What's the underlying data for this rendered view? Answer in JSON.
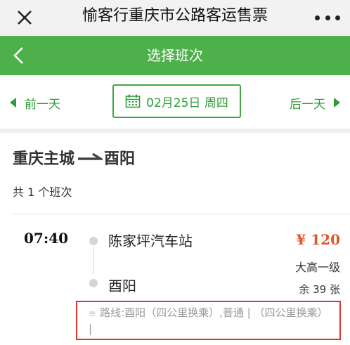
{
  "wechat_bar": {
    "title": "愉客行重庆市公路客运售票"
  },
  "nav": {
    "title": "选择班次"
  },
  "date_selector": {
    "prev_label": "前一天",
    "current_date": "02月25日 周四",
    "next_label": "后一天"
  },
  "route": {
    "from": "重庆主城",
    "to": "酉阳",
    "trip_count": "共 1 个班次"
  },
  "trips": [
    {
      "time": "07:40",
      "from_station": "陈家坪汽车站",
      "to_station": "酉阳",
      "price": "¥ 120",
      "bus_type": "大高一级",
      "seats_left": "余 39 张",
      "route_info": "路线:酉阳（四公里换乘）,普通 | （四公里换乘） |",
      "route_icon": "≡"
    }
  ],
  "colors": {
    "nav_green": "#4db04a",
    "accent_green": "#2e9d3a",
    "price_orange": "#e0562c",
    "highlight_red": "#e23333"
  },
  "icons": {
    "close": "close-icon",
    "more": "more-dots-icon",
    "back": "chevron-left-icon",
    "calendar": "calendar-icon",
    "route_arrow": "route-arrow-icon"
  }
}
